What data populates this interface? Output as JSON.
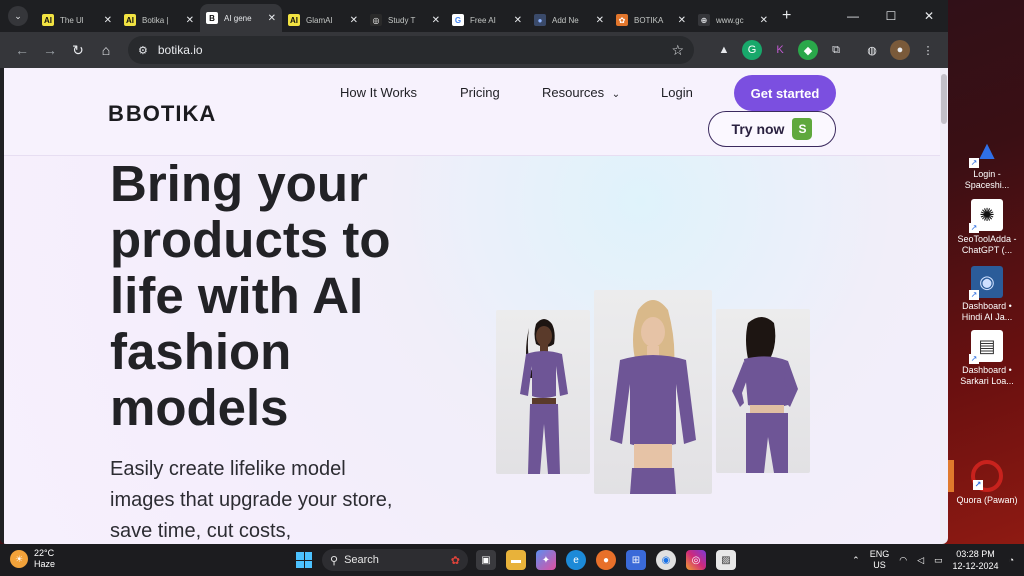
{
  "browser": {
    "tabs": [
      {
        "title": "The Ul",
        "favicon": "AI",
        "fav_color": "#f2e342",
        "fav_text": "#111"
      },
      {
        "title": "Botika |",
        "favicon": "AI",
        "fav_color": "#f2e342",
        "fav_text": "#111"
      },
      {
        "title": "AI gene",
        "favicon": "B",
        "fav_color": "#ffffff",
        "fav_text": "#111",
        "active": true
      },
      {
        "title": "GlamAI",
        "favicon": "AI",
        "fav_color": "#f2e342",
        "fav_text": "#111"
      },
      {
        "title": "Study T",
        "favicon": "◎",
        "fav_color": "#2a2a2a",
        "fav_text": "#fff"
      },
      {
        "title": "Free AI",
        "favicon": "G",
        "fav_color": "#ffffff",
        "fav_text": "#4285f4"
      },
      {
        "title": "Add Ne",
        "favicon": "●",
        "fav_color": "#3a4a6a",
        "fav_text": "#8fb4ff"
      },
      {
        "title": "BOTIKA",
        "favicon": "✿",
        "fav_color": "#e2762c",
        "fav_text": "#fff"
      },
      {
        "title": "www.gc",
        "favicon": "⊕",
        "fav_color": "#35363a",
        "fav_text": "#e8eaed"
      }
    ],
    "url": "botika.io"
  },
  "site": {
    "logo_mark": "B",
    "logo_text": "BOTIKA",
    "nav": {
      "how_it_works": "How It Works",
      "pricing": "Pricing",
      "resources": "Resources",
      "login": "Login"
    },
    "get_started": "Get started",
    "try_now": "Try now",
    "hero_title": "Bring your products to life with AI fashion models",
    "hero_subtitle": "Easily create lifelike model images that upgrade your store, save time, cut costs,"
  },
  "desktop_icons": [
    {
      "label": "Login - Spaceshi...",
      "icon": "▲",
      "color": "#2f6fe8"
    },
    {
      "label": "SeoToolAdda - ChatGPT (...",
      "icon": "✺",
      "color": "#ffffff"
    },
    {
      "label": "Dashboard • Hindi AI Ja...",
      "icon": "◉",
      "color": "#2b5c99"
    },
    {
      "label": "Dashboard • Sarkari Loa...",
      "icon": "▤",
      "color": "#ffffff"
    },
    {
      "label": "Quora (Pawan)",
      "icon": "Q",
      "color": "#b92b27"
    }
  ],
  "taskbar": {
    "temperature": "22°C",
    "weather": "Haze",
    "search": "Search",
    "language": "ENG",
    "region": "US",
    "time": "03:28 PM",
    "date": "12-12-2024"
  }
}
